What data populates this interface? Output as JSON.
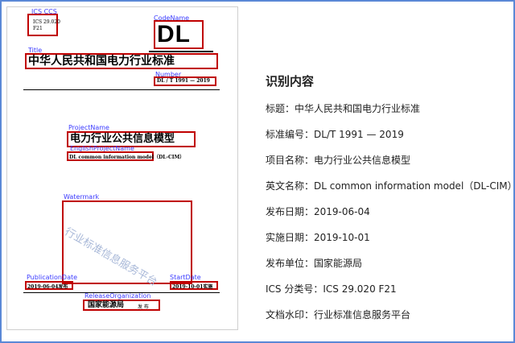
{
  "doc": {
    "ics_ccs": {
      "tag": "ICS CCS",
      "ics": "ICS 29.020",
      "ccs": "F21"
    },
    "code_name": {
      "tag": "CodeName",
      "value": "DL"
    },
    "title": {
      "tag": "Title",
      "value": "中华人民共和国电力行业标准"
    },
    "number": {
      "tag": "Number",
      "value": "DL / T  1991 — 2019"
    },
    "project_name": {
      "tag": "ProjectName",
      "value": "电力行业公共信息模型"
    },
    "english_project_name": {
      "tag": "EnglishProjectName",
      "value": "DL common information model（DL-CIM）"
    },
    "watermark": {
      "tag": "Watermark",
      "value": "行业标准信息服务平台"
    },
    "publication_date": {
      "tag": "PublicationDate",
      "value": "2019-06-04发布"
    },
    "start_date": {
      "tag": "StartDate",
      "value": "2019-10-01实施"
    },
    "release_organization": {
      "tag": "ReleaseOrganization",
      "org": "国家能源局",
      "suffix": "发 布"
    }
  },
  "panel": {
    "heading": "识别内容",
    "rows": [
      {
        "key": "标题：",
        "value": "中华人民共和国电力行业标准"
      },
      {
        "key": "标准编号：",
        "value": "DL/T 1991 — 2019"
      },
      {
        "key": "项目名称：",
        "value": "电力行业公共信息模型"
      },
      {
        "key": "英文名称：",
        "value": "DL common information model（DL-CIM）"
      },
      {
        "key": "发布日期：",
        "value": "2019-06-04"
      },
      {
        "key": "实施日期：",
        "value": "2019-10-01"
      },
      {
        "key": "发布单位：",
        "value": "国家能源局"
      },
      {
        "key": "ICS 分类号：",
        "value": "ICS 29.020 F21"
      },
      {
        "key": "文档水印：",
        "value": "行业标准信息服务平台"
      }
    ]
  },
  "colors": {
    "frame": "#5a88d6",
    "box": "#c00000",
    "tag": "#3b3bff"
  }
}
